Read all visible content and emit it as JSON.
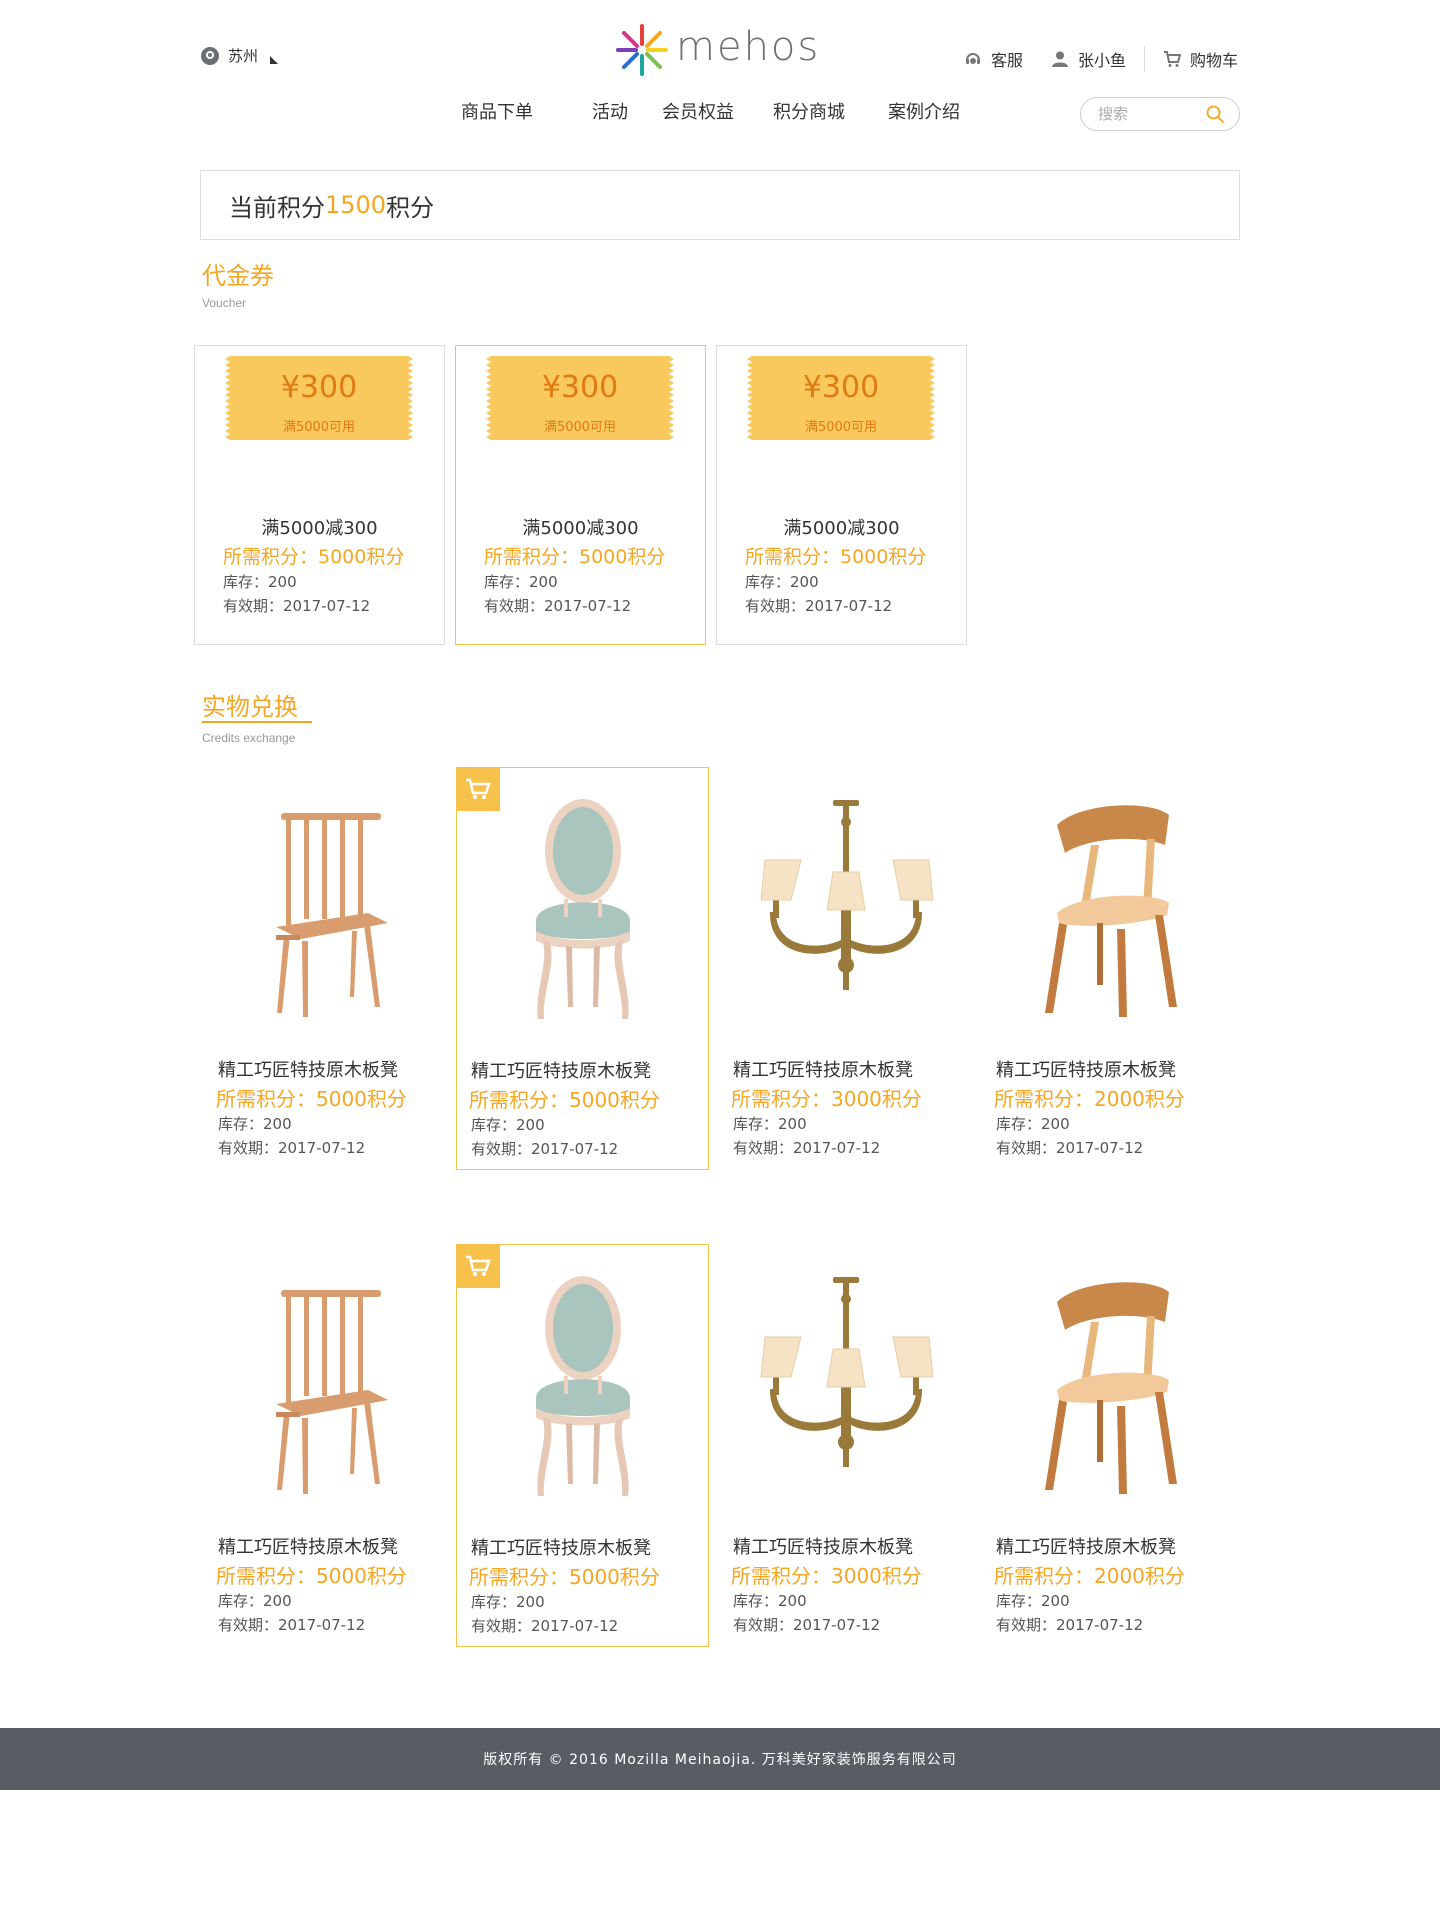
{
  "header": {
    "location": "苏州",
    "logo_text": "mehos",
    "service": "客服",
    "user": "张小鱼",
    "cart": "购物车",
    "search_placeholder": "搜索"
  },
  "nav": [
    {
      "label": "商品下单"
    },
    {
      "label": "活动"
    },
    {
      "label": "会员权益"
    },
    {
      "label": "积分商城"
    },
    {
      "label": "案例介绍"
    }
  ],
  "points_banner": {
    "prefix": "当前积分",
    "value": "1500",
    "suffix": "积分"
  },
  "voucher_section": {
    "title": "代金券",
    "subtitle": "Voucher"
  },
  "vouchers": [
    {
      "amount": "¥300",
      "condition": "满5000可用",
      "name": "满5000减300",
      "points": "所需积分：5000积分",
      "stock": "库存：200",
      "expiry": "有效期：2017-07-12"
    },
    {
      "amount": "¥300",
      "condition": "满5000可用",
      "name": "满5000减300",
      "points": "所需积分：5000积分",
      "stock": "库存：200",
      "expiry": "有效期：2017-07-12"
    },
    {
      "amount": "¥300",
      "condition": "满5000可用",
      "name": "满5000减300",
      "points": "所需积分：5000积分",
      "stock": "库存：200",
      "expiry": "有效期：2017-07-12"
    }
  ],
  "credits_section": {
    "title": "实物兑换",
    "subtitle": "Credits exchange"
  },
  "products": [
    {
      "image": "spindle-chair",
      "name": "精工巧匠特技原木板凳",
      "points": "所需积分：5000积分",
      "stock": "库存：200",
      "expiry": "有效期：2017-07-12"
    },
    {
      "image": "upholstered-chair",
      "name": "精工巧匠特技原木板凳",
      "points": "所需积分：5000积分",
      "stock": "库存：200",
      "expiry": "有效期：2017-07-12"
    },
    {
      "image": "chandelier",
      "name": "精工巧匠特技原木板凳",
      "points": "所需积分：3000积分",
      "stock": "库存：200",
      "expiry": "有效期：2017-07-12"
    },
    {
      "image": "wood-chair",
      "name": "精工巧匠特技原木板凳",
      "points": "所需积分：2000积分",
      "stock": "库存：200",
      "expiry": "有效期：2017-07-12"
    },
    {
      "image": "spindle-chair",
      "name": "精工巧匠特技原木板凳",
      "points": "所需积分：5000积分",
      "stock": "库存：200",
      "expiry": "有效期：2017-07-12"
    },
    {
      "image": "upholstered-chair",
      "name": "精工巧匠特技原木板凳",
      "points": "所需积分：5000积分",
      "stock": "库存：200",
      "expiry": "有效期：2017-07-12"
    },
    {
      "image": "chandelier",
      "name": "精工巧匠特技原木板凳",
      "points": "所需积分：3000积分",
      "stock": "库存：200",
      "expiry": "有效期：2017-07-12"
    },
    {
      "image": "wood-chair",
      "name": "精工巧匠特技原木板凳",
      "points": "所需积分：2000积分",
      "stock": "库存：200",
      "expiry": "有效期：2017-07-12"
    }
  ],
  "footer": {
    "text": "版权所有 © 2016 Mozilla Meihaojia. 万科美好家装饰服务有限公司"
  },
  "colors": {
    "accent": "#f5a623",
    "coupon": "#f9c95e",
    "coupon_text": "#e07a12",
    "footer_bg": "#595c63"
  }
}
